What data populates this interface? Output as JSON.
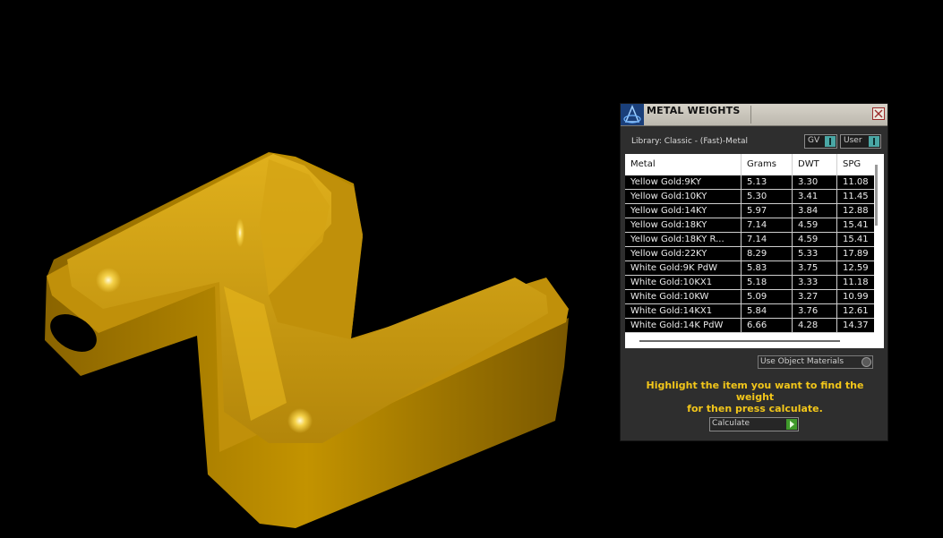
{
  "panel": {
    "title": "METAL WEIGHTS",
    "library_label": "Library: Classic - (Fast)-Metal",
    "toggles": {
      "gv": "GV",
      "user": "User"
    },
    "columns": [
      "Metal",
      "Grams",
      "DWT",
      "SPG"
    ],
    "rows": [
      [
        "Yellow Gold:9KY",
        "5.13",
        "3.30",
        "11.08"
      ],
      [
        "Yellow Gold:10KY",
        "5.30",
        "3.41",
        "11.45"
      ],
      [
        "Yellow Gold:14KY",
        "5.97",
        "3.84",
        "12.88"
      ],
      [
        "Yellow Gold:18KY",
        "7.14",
        "4.59",
        "15.41"
      ],
      [
        "Yellow Gold:18KY R...",
        "7.14",
        "4.59",
        "15.41"
      ],
      [
        "Yellow Gold:22KY",
        "8.29",
        "5.33",
        "17.89"
      ],
      [
        "White Gold:9K PdW",
        "5.83",
        "3.75",
        "12.59"
      ],
      [
        "White Gold:10KX1",
        "5.18",
        "3.33",
        "11.18"
      ],
      [
        "White Gold:10KW",
        "5.09",
        "3.27",
        "10.99"
      ],
      [
        "White Gold:14KX1",
        "5.84",
        "3.76",
        "12.61"
      ],
      [
        "White Gold:14K PdW",
        "6.66",
        "4.28",
        "14.37"
      ]
    ],
    "material_dropdown": "Use Object Materials",
    "hint_line1": "Highlight the item you want to find the weight",
    "hint_line2": "for then press calculate.",
    "calculate_label": "Calculate"
  },
  "colors": {
    "gold_main": "#c99a0e",
    "hint_text": "#f2c61a",
    "toggle_accent": "#4aa7a5",
    "calc_accent": "#3f9a2b"
  }
}
